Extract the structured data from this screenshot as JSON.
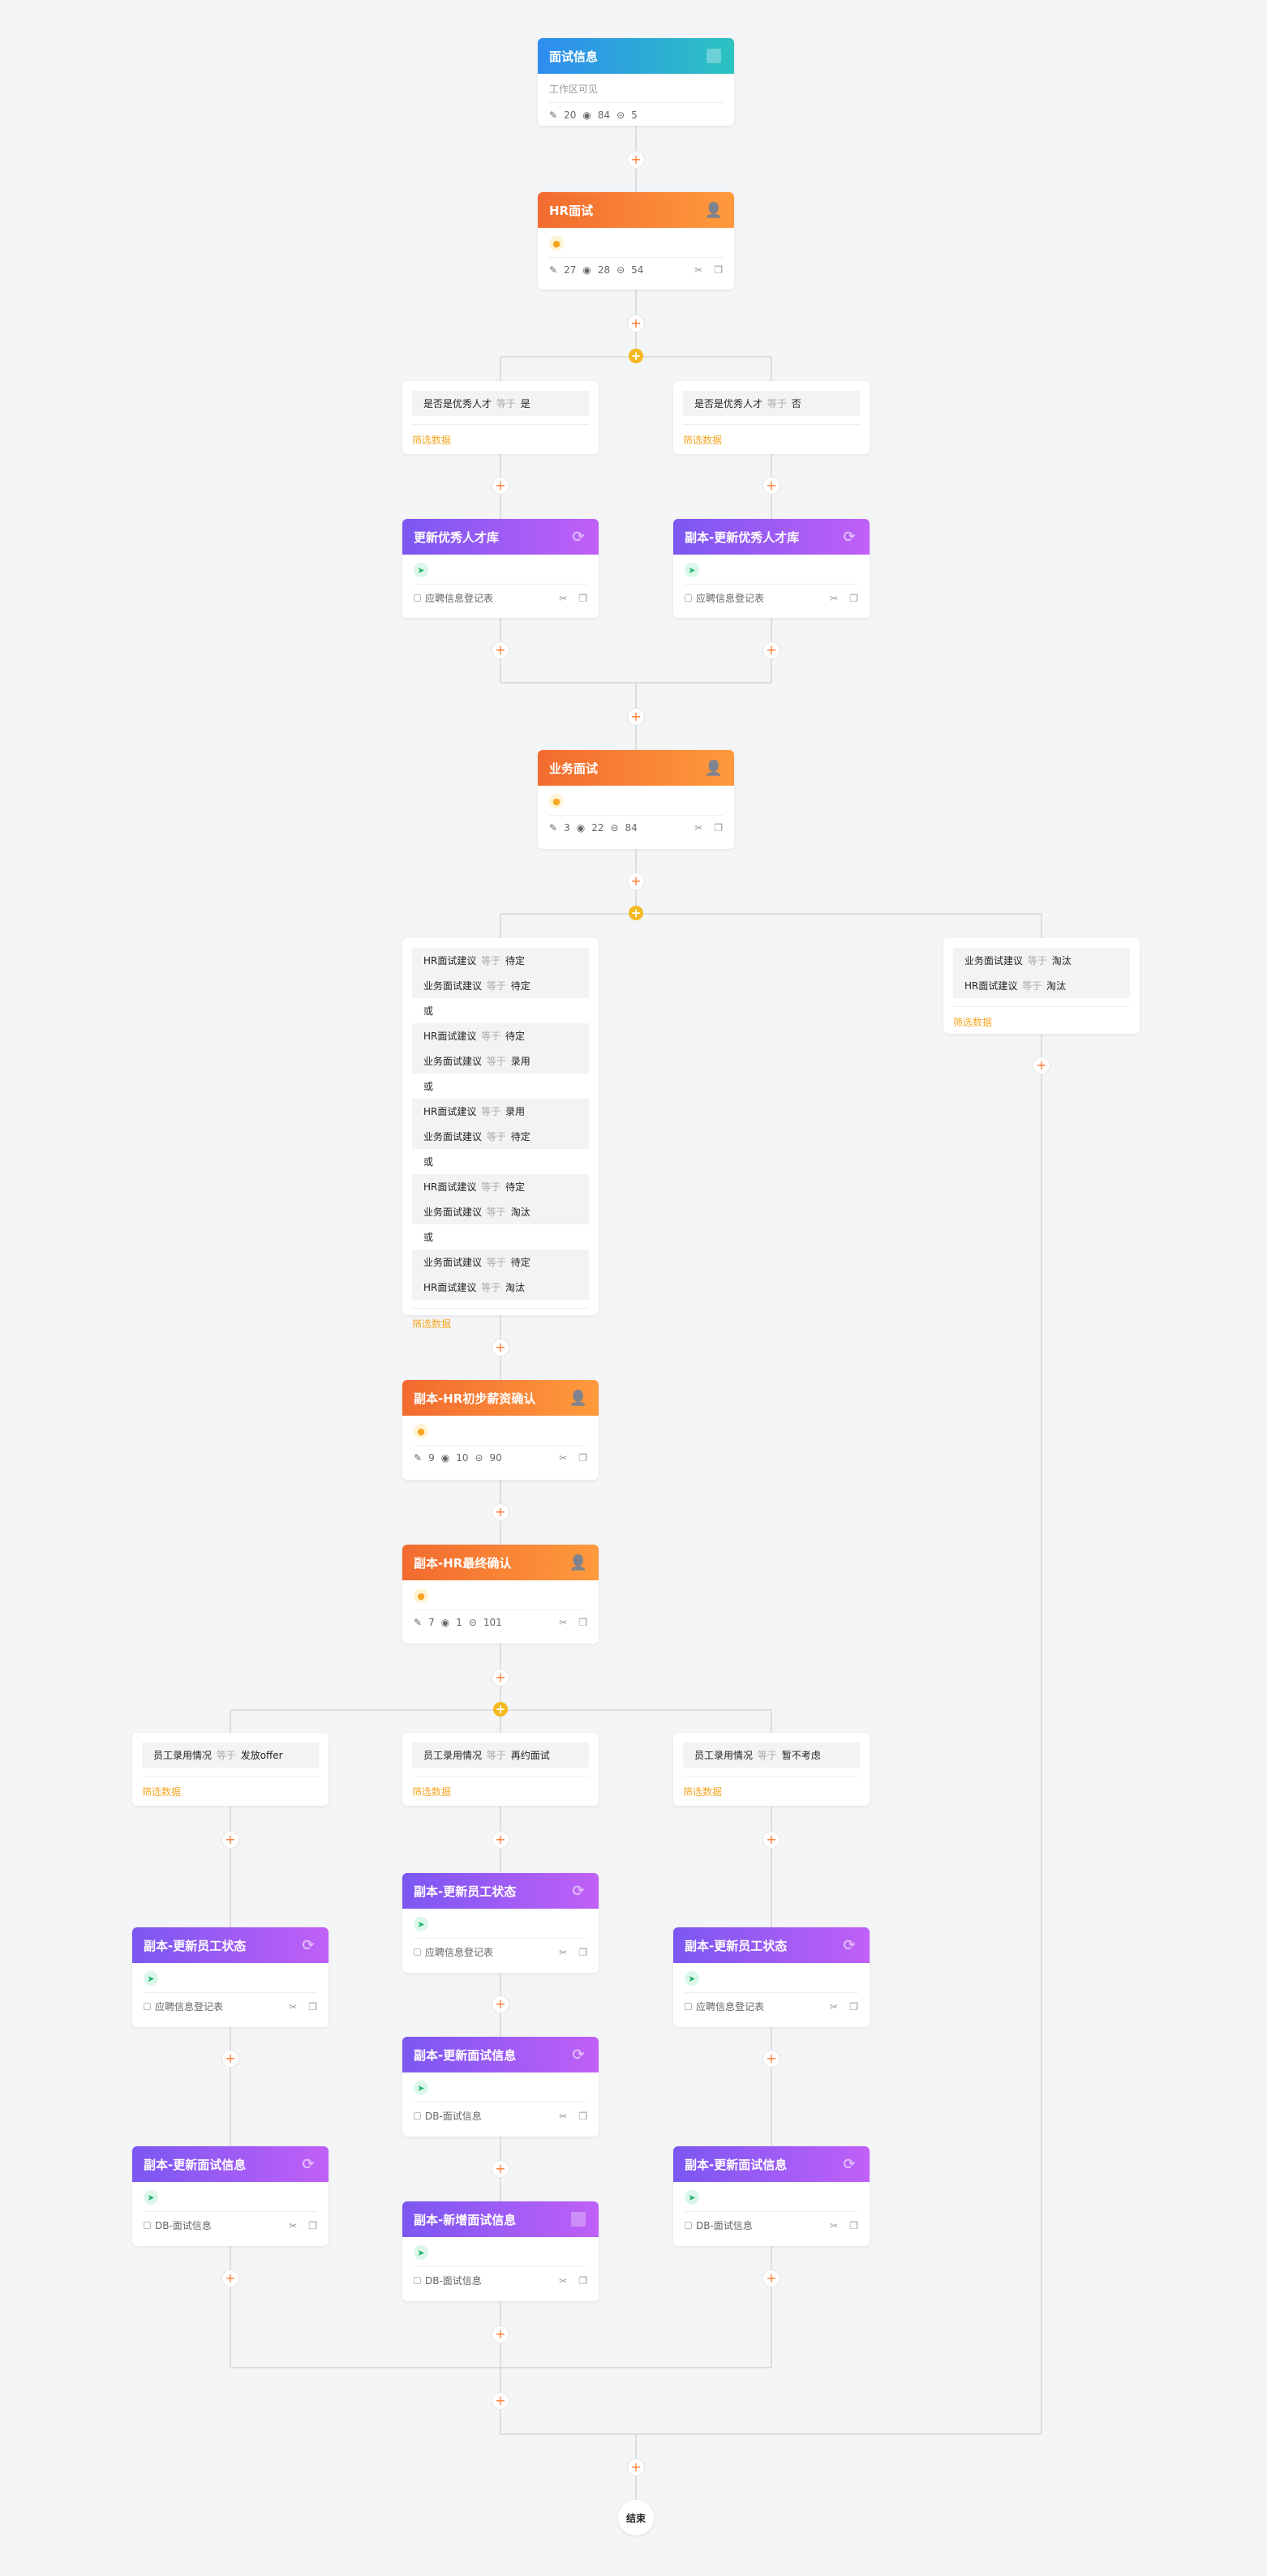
{
  "start": {
    "title": "面试信息",
    "subtitle": "工作区可见",
    "edit": "20",
    "view": "84",
    "link": "5"
  },
  "hr": {
    "title": "HR面试",
    "edit": "27",
    "view": "28",
    "link": "54"
  },
  "talent_yes": {
    "field": "是否是优秀人才",
    "op": "等于",
    "value": "是",
    "filter": "筛选数据"
  },
  "talent_no": {
    "field": "是否是优秀人才",
    "op": "等于",
    "value": "否",
    "filter": "筛选数据"
  },
  "update_talent": {
    "title": "更新优秀人才库",
    "table": "应聘信息登记表"
  },
  "copy_update_talent": {
    "title": "副本-更新优秀人才库",
    "table": "应聘信息登记表"
  },
  "biz": {
    "title": "业务面试",
    "edit": "3",
    "view": "22",
    "link": "84"
  },
  "big_cond": {
    "rows": [
      {
        "kind": "c",
        "field": "HR面试建议",
        "op": "等于",
        "value": "待定"
      },
      {
        "kind": "c",
        "field": "业务面试建议",
        "op": "等于",
        "value": "待定"
      },
      {
        "kind": "or",
        "text": "或"
      },
      {
        "kind": "c",
        "field": "HR面试建议",
        "op": "等于",
        "value": "待定"
      },
      {
        "kind": "c",
        "field": "业务面试建议",
        "op": "等于",
        "value": "录用"
      },
      {
        "kind": "or",
        "text": "或"
      },
      {
        "kind": "c",
        "field": "HR面试建议",
        "op": "等于",
        "value": "录用"
      },
      {
        "kind": "c",
        "field": "业务面试建议",
        "op": "等于",
        "value": "待定"
      },
      {
        "kind": "or",
        "text": "或"
      },
      {
        "kind": "c",
        "field": "HR面试建议",
        "op": "等于",
        "value": "待定"
      },
      {
        "kind": "c",
        "field": "业务面试建议",
        "op": "等于",
        "value": "淘汰"
      },
      {
        "kind": "or",
        "text": "或"
      },
      {
        "kind": "c",
        "field": "业务面试建议",
        "op": "等于",
        "value": "待定"
      },
      {
        "kind": "c",
        "field": "HR面试建议",
        "op": "等于",
        "value": "淘汰"
      }
    ],
    "filter": "筛选数据"
  },
  "right_cond": {
    "rows": [
      {
        "kind": "c",
        "field": "业务面试建议",
        "op": "等于",
        "value": "淘汰"
      },
      {
        "kind": "c",
        "field": "HR面试建议",
        "op": "等于",
        "value": "淘汰"
      }
    ],
    "filter": "筛选数据"
  },
  "salary": {
    "title": "副本-HR初步薪资确认",
    "edit": "9",
    "view": "10",
    "link": "90"
  },
  "final": {
    "title": "副本-HR最终确认",
    "edit": "7",
    "view": "1",
    "link": "101"
  },
  "cond_offer": {
    "field": "员工录用情况",
    "op": "等于",
    "value": "发放offer",
    "filter": "筛选数据"
  },
  "cond_again": {
    "field": "员工录用情况",
    "op": "等于",
    "value": "再约面试",
    "filter": "筛选数据"
  },
  "cond_hold": {
    "field": "员工录用情况",
    "op": "等于",
    "value": "暂不考虑",
    "filter": "筛选数据"
  },
  "l_status": {
    "title": "副本-更新员工状态",
    "table": "应聘信息登记表"
  },
  "l_info": {
    "title": "副本-更新面试信息",
    "table": "DB-面试信息"
  },
  "m_status": {
    "title": "副本-更新员工状态",
    "table": "应聘信息登记表"
  },
  "m_info": {
    "title": "副本-更新面试信息",
    "table": "DB-面试信息"
  },
  "m_new": {
    "title": "副本-新增面试信息",
    "table": "DB-面试信息"
  },
  "r_status": {
    "title": "副本-更新员工状态",
    "table": "应聘信息登记表"
  },
  "r_info": {
    "title": "副本-更新面试信息",
    "table": "DB-面试信息"
  },
  "end": {
    "label": "结束"
  },
  "icons": {
    "edit": "pencil-icon",
    "view": "eye-icon",
    "link": "link-icon",
    "copy": "copy-icon",
    "cut": "scissors-icon",
    "user": "user-icon",
    "refresh": "refresh-icon",
    "send": "send-icon",
    "table": "table-icon"
  },
  "colors": {
    "blue": "#2e8cf0",
    "orange": "#f26b2f",
    "purple": "#7b57f2",
    "branch": "#f5b921",
    "plus": "#ff7a2f",
    "filter": "#f5a623"
  }
}
